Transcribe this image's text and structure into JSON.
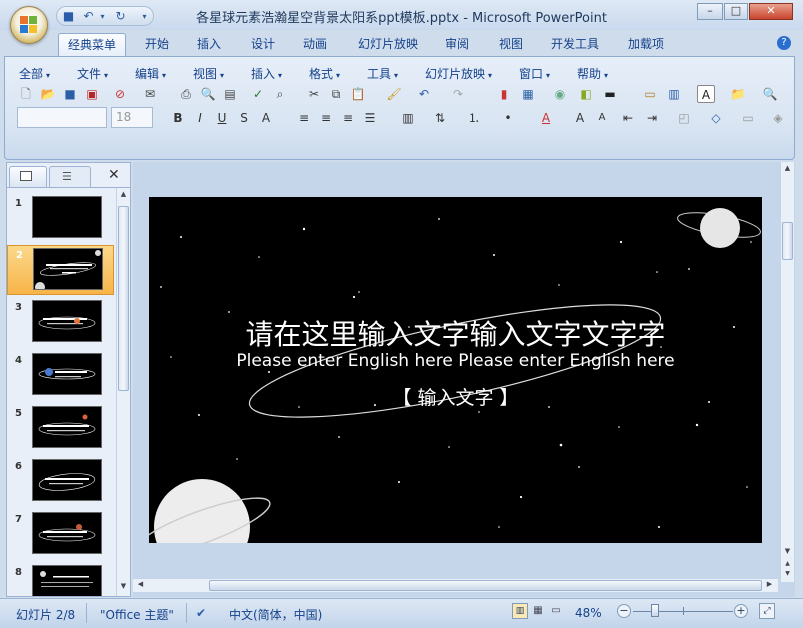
{
  "window": {
    "title": "各星球元素浩瀚星空背景太阳系ppt模板.pptx - Microsoft PowerPoint",
    "controls": {
      "minimize": "–",
      "maximize": "□",
      "close": "✕"
    }
  },
  "tabs": [
    {
      "label": "经典菜单",
      "active": true
    },
    {
      "label": "开始"
    },
    {
      "label": "插入"
    },
    {
      "label": "设计"
    },
    {
      "label": "动画"
    },
    {
      "label": "幻灯片放映"
    },
    {
      "label": "审阅"
    },
    {
      "label": "视图"
    },
    {
      "label": "开发工具"
    },
    {
      "label": "加载项"
    }
  ],
  "menu": [
    "全部",
    "文件",
    "编辑",
    "视图",
    "插入",
    "格式",
    "工具",
    "幻灯片放映",
    "窗口",
    "帮助"
  ],
  "format": {
    "font_size": "18"
  },
  "slides": [
    {
      "num": "1"
    },
    {
      "num": "2"
    },
    {
      "num": "3"
    },
    {
      "num": "4"
    },
    {
      "num": "5"
    },
    {
      "num": "6"
    },
    {
      "num": "7"
    },
    {
      "num": "8"
    }
  ],
  "slide_content": {
    "title": "请在这里输入文字输入文字文字字",
    "subtitle": "Please enter English here Please enter English here",
    "tag": "【 输入文字 】"
  },
  "status": {
    "slide_info": "幻灯片 2/8",
    "theme": "\"Office 主题\"",
    "language": "中文(简体，中国)",
    "zoom": "48%"
  },
  "colors": {
    "selected_thumb": "#f7b449",
    "ribbon_bg": "#d8e4f2",
    "slide_bg": "#000000"
  }
}
